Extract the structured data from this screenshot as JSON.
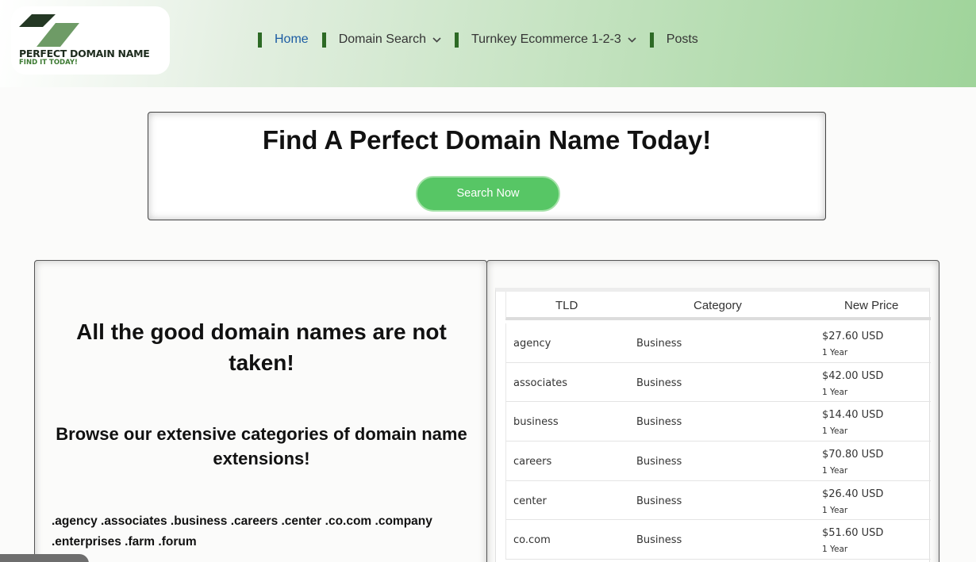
{
  "header": {
    "logo": {
      "title": "PERFECT DOMAIN NAME",
      "tagline": "FIND IT TODAY!"
    },
    "nav": [
      {
        "label": "Home",
        "active": true,
        "dropdown": false
      },
      {
        "label": "Domain Search",
        "active": false,
        "dropdown": true
      },
      {
        "label": "Turnkey Ecommerce 1-2-3",
        "active": false,
        "dropdown": true
      },
      {
        "label": "Posts",
        "active": false,
        "dropdown": false
      }
    ]
  },
  "hero": {
    "title": "Find A Perfect Domain Name Today!",
    "button_label": "Search Now"
  },
  "left_panel": {
    "heading": "All the good domain names are not taken!",
    "subheading": "Browse our extensive categories of domain name extensions!",
    "extensions": ".agency .associates .business .careers .center .co.com .company .enterprises .farm .forum"
  },
  "tld_table": {
    "columns": [
      "TLD",
      "Category",
      "New Price"
    ],
    "rows": [
      {
        "tld": "agency",
        "category": "Business",
        "price": "$27.60 USD",
        "period": "1 Year"
      },
      {
        "tld": "associates",
        "category": "Business",
        "price": "$42.00 USD",
        "period": "1 Year"
      },
      {
        "tld": "business",
        "category": "Business",
        "price": "$14.40 USD",
        "period": "1 Year"
      },
      {
        "tld": "careers",
        "category": "Business",
        "price": "$70.80 USD",
        "period": "1 Year"
      },
      {
        "tld": "center",
        "category": "Business",
        "price": "$26.40 USD",
        "period": "1 Year"
      },
      {
        "tld": "co.com",
        "category": "Business",
        "price": "$51.60 USD",
        "period": "1 Year"
      }
    ]
  },
  "colors": {
    "nav_accent": "#2d6a25",
    "nav_active": "#1c5ca3",
    "button_green": "#57c665"
  }
}
